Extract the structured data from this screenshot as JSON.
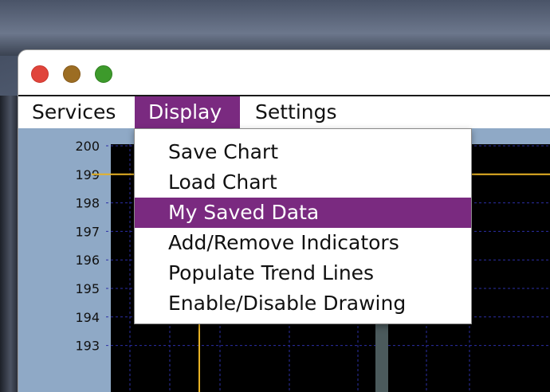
{
  "menubar": {
    "items": [
      {
        "label": "Services"
      },
      {
        "label": "Display",
        "active": true
      },
      {
        "label": "Settings"
      }
    ]
  },
  "dropdown": {
    "items": [
      {
        "label": "Save Chart"
      },
      {
        "label": "Load Chart"
      },
      {
        "label": "My Saved Data",
        "selected": true
      },
      {
        "label": "Add/Remove Indicators"
      },
      {
        "label": "Populate Trend Lines"
      },
      {
        "label": "Enable/Disable Drawing"
      }
    ]
  },
  "colors": {
    "accent": "#7a2a80",
    "chart_background": "#000000",
    "content_background": "#8fa9c6",
    "grid": "#2c2fa6",
    "price_line": "#e8b325"
  },
  "chart_data": {
    "type": "line",
    "ylim": [
      193,
      200
    ],
    "yticks": [
      "200",
      "199",
      "198",
      "197",
      "196",
      "195",
      "194",
      "193"
    ],
    "horizontal_line_value": 199,
    "grid": true
  }
}
